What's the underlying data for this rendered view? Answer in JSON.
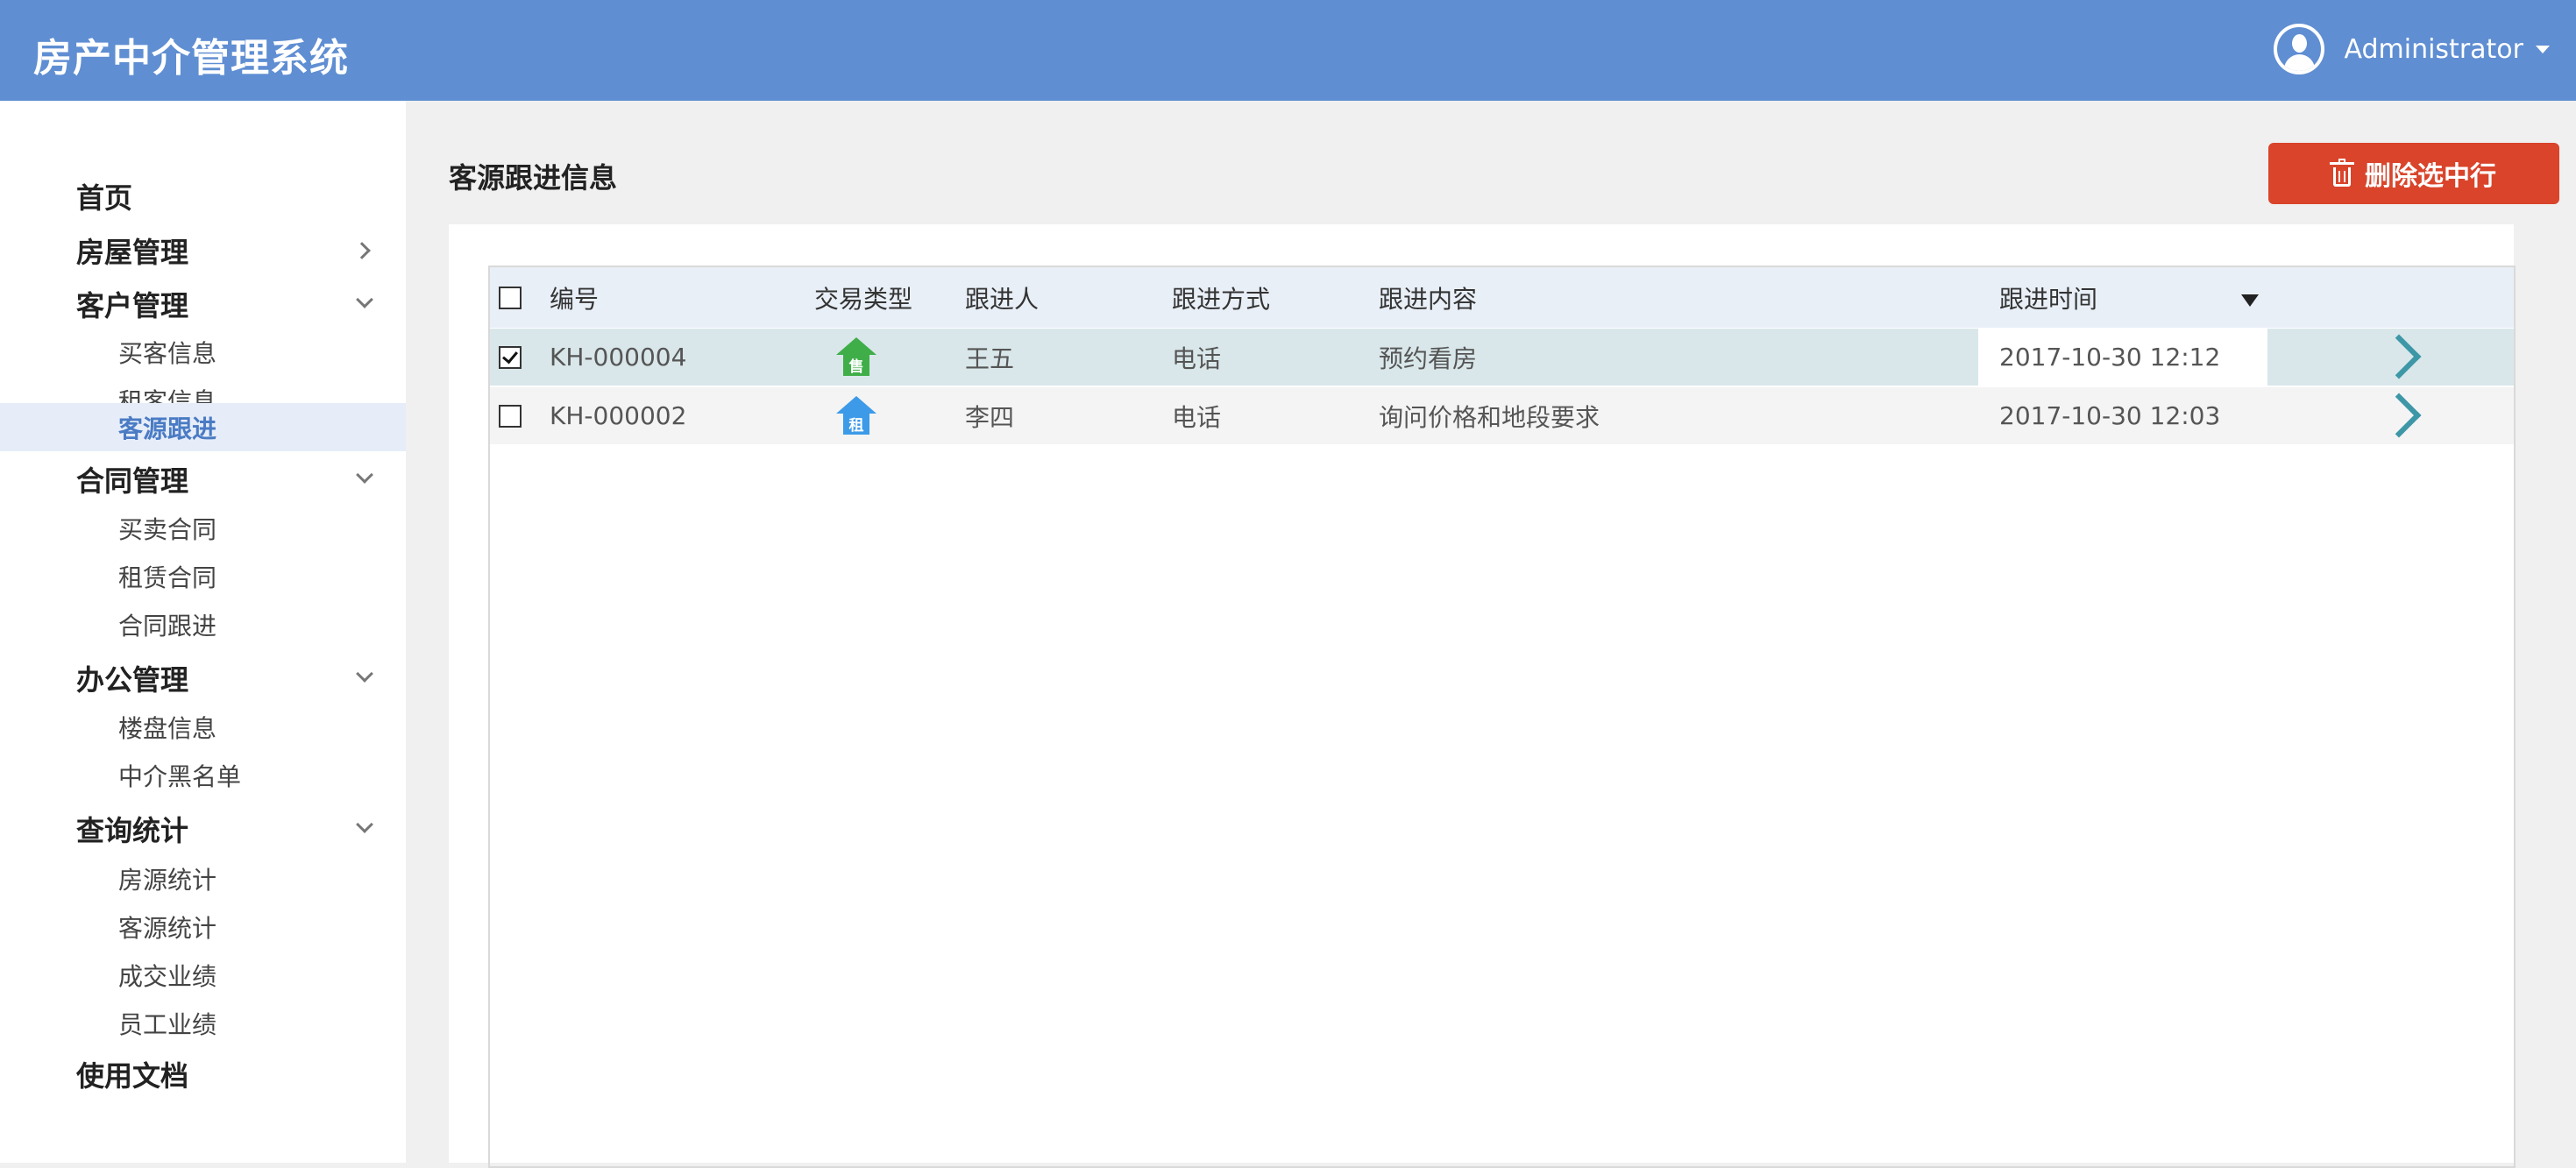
{
  "header": {
    "app_title": "房产中介管理系统",
    "user_name": "Administrator",
    "avatar_icon": "user-avatar-icon",
    "dropdown_icon": "caret-down-icon",
    "bg_color": "#5f8ed2"
  },
  "sidebar": {
    "home": "首页",
    "housing": {
      "label": "房屋管理",
      "icon": "chevron-right-icon"
    },
    "customers": {
      "label": "客户管理",
      "icon": "chevron-down-icon",
      "items": [
        "买客信息",
        "租客信息",
        "客源跟进"
      ],
      "active": "客源跟进"
    },
    "contracts": {
      "label": "合同管理",
      "icon": "chevron-down-icon",
      "items": [
        "买卖合同",
        "租赁合同",
        "合同跟进"
      ]
    },
    "office": {
      "label": "办公管理",
      "icon": "chevron-down-icon",
      "items": [
        "楼盘信息",
        "中介黑名单"
      ]
    },
    "stats": {
      "label": "查询统计",
      "icon": "chevron-down-icon",
      "items": [
        "房源统计",
        "客源统计",
        "成交业绩",
        "员工业绩"
      ]
    },
    "docs": "使用文档"
  },
  "main": {
    "title": "客源跟进信息",
    "delete_button": {
      "label": "删除选中行",
      "icon": "trash-icon",
      "color": "#d9442b"
    }
  },
  "table": {
    "columns": [
      "编号",
      "交易类型",
      "跟进人",
      "跟进方式",
      "跟进内容",
      "跟进时间"
    ],
    "sort_icon": "sort-desc-icon",
    "rows": [
      {
        "checked": true,
        "id": "KH-000004",
        "type_badge": "售",
        "type_color": "#3fae49",
        "person": "王五",
        "method": "电话",
        "content": "预约看房",
        "time": "2017-10-30 12:12",
        "action_icon": "chevron-right-icon"
      },
      {
        "checked": false,
        "id": "KH-000002",
        "type_badge": "租",
        "type_color": "#3d9ae8",
        "person": "李四",
        "method": "电话",
        "content": "询问价格和地段要求",
        "time": "2017-10-30 12:03",
        "action_icon": "chevron-right-icon"
      }
    ]
  }
}
